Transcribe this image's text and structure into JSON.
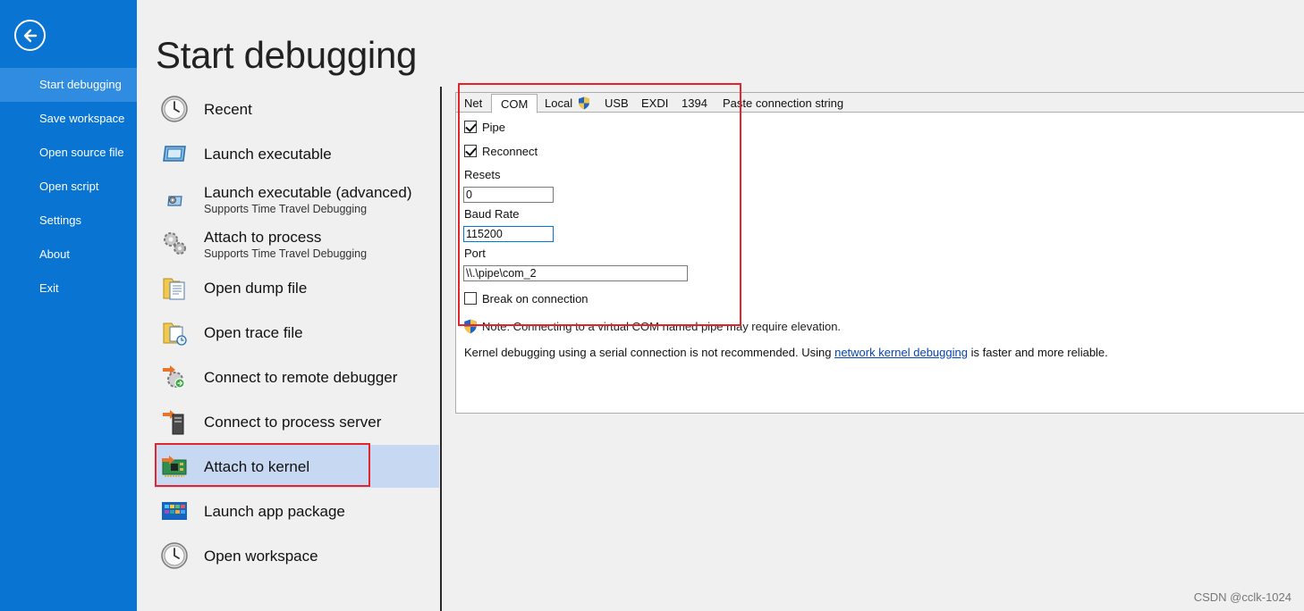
{
  "sidebar": {
    "items": [
      {
        "label": "Start debugging"
      },
      {
        "label": "Save workspace"
      },
      {
        "label": "Open source file"
      },
      {
        "label": "Open script"
      },
      {
        "label": "Settings"
      },
      {
        "label": "About"
      },
      {
        "label": "Exit"
      }
    ]
  },
  "page": {
    "title": "Start debugging"
  },
  "menu": {
    "items": [
      {
        "label": "Recent",
        "sub": "",
        "icon": "clock-icon"
      },
      {
        "label": "Launch executable",
        "sub": "",
        "icon": "window-icon"
      },
      {
        "label": "Launch executable (advanced)",
        "sub": "Supports Time Travel Debugging",
        "icon": "window-gear-icon"
      },
      {
        "label": "Attach to process",
        "sub": "Supports Time Travel Debugging",
        "icon": "gears-icon"
      },
      {
        "label": "Open dump file",
        "sub": "",
        "icon": "dump-file-icon"
      },
      {
        "label": "Open trace file",
        "sub": "",
        "icon": "trace-file-icon"
      },
      {
        "label": "Connect to remote debugger",
        "sub": "",
        "icon": "remote-debugger-icon"
      },
      {
        "label": "Connect to process server",
        "sub": "",
        "icon": "server-icon"
      },
      {
        "label": "Attach to kernel",
        "sub": "",
        "icon": "circuit-board-icon"
      },
      {
        "label": "Launch app package",
        "sub": "",
        "icon": "app-package-icon"
      },
      {
        "label": "Open workspace",
        "sub": "",
        "icon": "clock-icon"
      }
    ]
  },
  "tabs": [
    {
      "label": "Net"
    },
    {
      "label": "COM"
    },
    {
      "label": "Local"
    },
    {
      "label": "USB"
    },
    {
      "label": "EXDI"
    },
    {
      "label": "1394"
    },
    {
      "label": "Paste connection string"
    }
  ],
  "com": {
    "pipe_label": "Pipe",
    "pipe_checked": true,
    "reconnect_label": "Reconnect",
    "reconnect_checked": true,
    "resets_label": "Resets",
    "resets_value": "0",
    "baud_label": "Baud Rate",
    "baud_value": "115200",
    "port_label": "Port",
    "port_value": "\\\\.\\pipe\\com_2",
    "break_label": "Break on connection",
    "break_checked": false,
    "note": "Note: Connecting to a virtual COM named pipe may require elevation.",
    "info_prefix": "Kernel debugging using a serial connection is not recommended. Using ",
    "info_link": "network kernel debugging",
    "info_suffix": " is faster and more reliable."
  },
  "watermark": "CSDN @cclk-1024",
  "colors": {
    "sidebar_bg": "#0a74d2",
    "sidebar_active": "#2f8ce0",
    "selected_item": "#c6d8f2",
    "highlight_border": "#e3242b",
    "link": "#0645ad"
  }
}
